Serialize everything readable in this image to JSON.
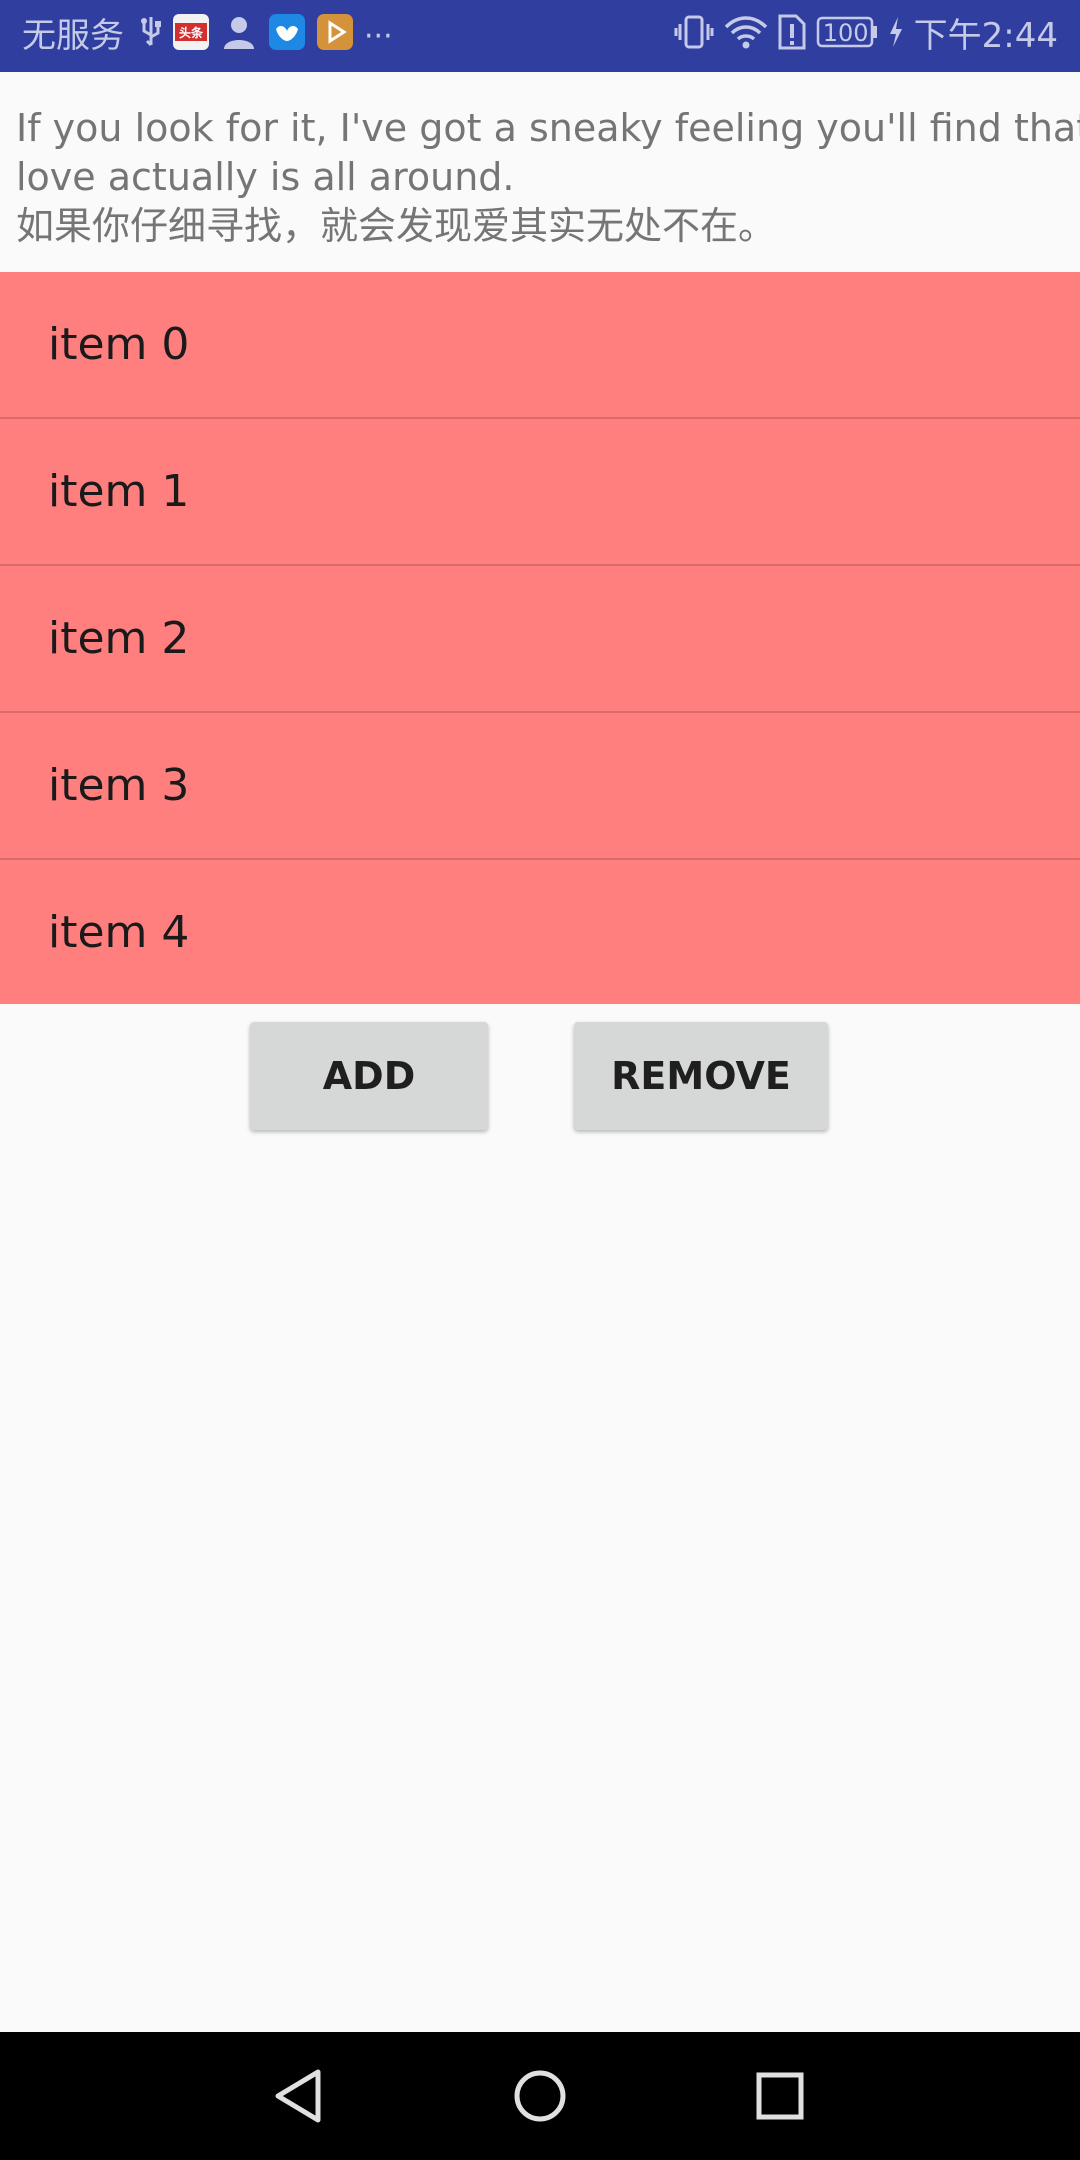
{
  "status_bar": {
    "carrier": "无服务",
    "time": "下午2:44",
    "battery": "100",
    "overflow": "···",
    "bg_color": "#303f9f",
    "left_icons": [
      "usb-icon",
      "toutiao-app-icon",
      "contacts-app-icon",
      "bird-app-icon",
      "video-app-icon"
    ],
    "right_icons": [
      "vibrate-icon",
      "wifi-icon",
      "sim-alert-icon",
      "battery-icon",
      "charging-icon"
    ]
  },
  "quote": {
    "line1": "If you look for it, I've got a sneaky feeling you'll find that",
    "line2": "love actually is all around.",
    "line3": "如果你仔细寻找，就会发现爱其实无处不在。"
  },
  "list": {
    "bg_color": "#ff7f7f",
    "items": [
      {
        "label": "item 0"
      },
      {
        "label": "item 1"
      },
      {
        "label": "item 2"
      },
      {
        "label": "item 3"
      },
      {
        "label": "item 4"
      }
    ]
  },
  "buttons": {
    "add_label": "ADD",
    "remove_label": "REMOVE"
  },
  "nav_bar": {
    "icons": [
      "back-icon",
      "home-icon",
      "recents-icon"
    ]
  }
}
